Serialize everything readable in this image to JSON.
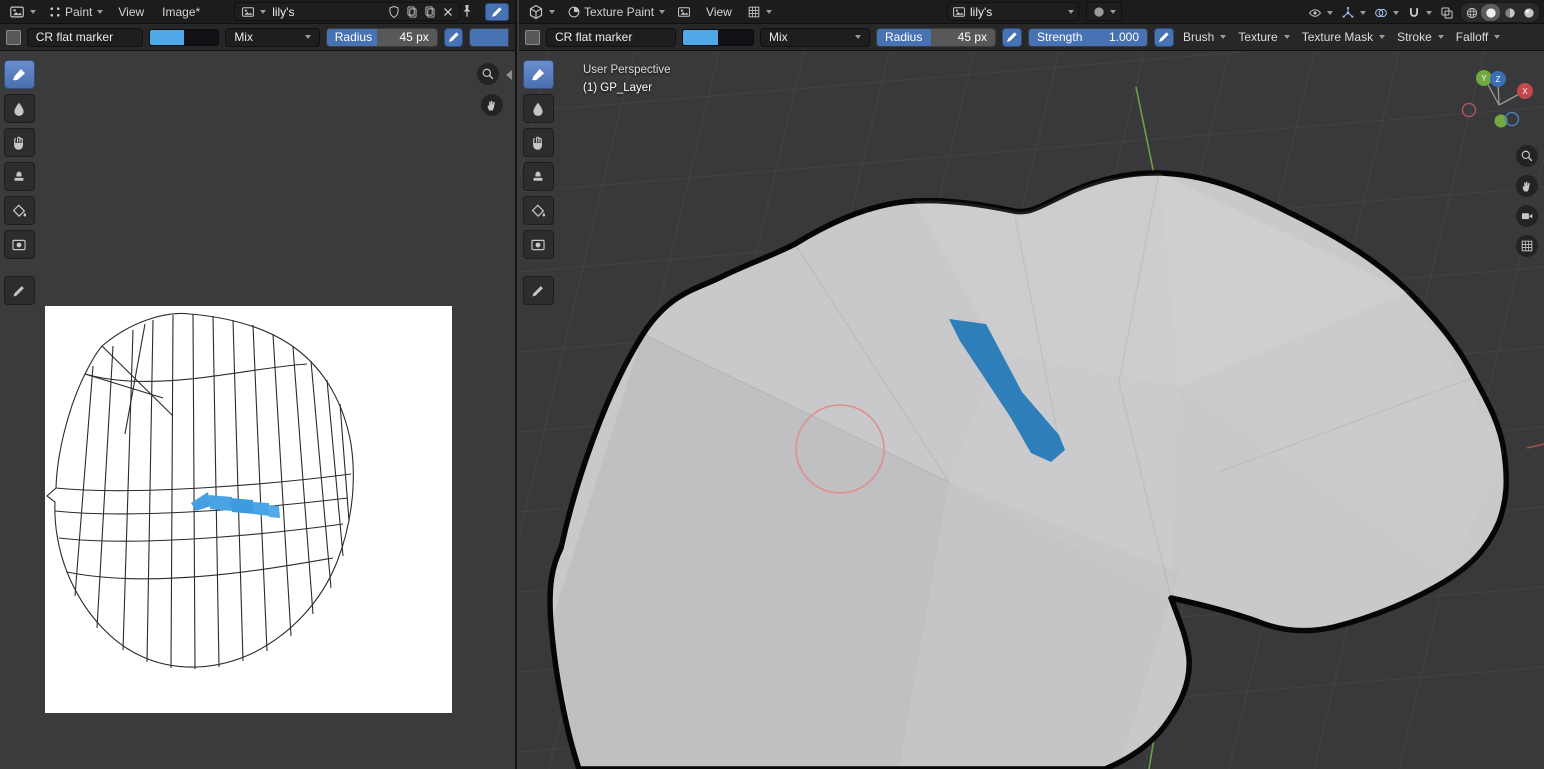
{
  "colors": {
    "accent_blue": "#4772b3",
    "brush_primary": "#4fa8e8",
    "brush_secondary": "#121216",
    "paint_stroke": "#2e7eb9",
    "cursor_pink": "#de8f8f"
  },
  "image_editor": {
    "header": {
      "mode_label": "Paint",
      "view_menu": "View",
      "image_menu": "Image*",
      "datablock_name": "lily's"
    },
    "tool_settings": {
      "brush_name": "CR flat marker",
      "blend_mode": "Mix",
      "radius_label": "Radius",
      "radius_value": "45 px"
    }
  },
  "viewport": {
    "header": {
      "mode_label": "Texture Paint",
      "view_menu": "View",
      "datablock_name": "lily's"
    },
    "tool_settings": {
      "brush_name": "CR flat marker",
      "blend_mode": "Mix",
      "radius_label": "Radius",
      "radius_value": "45 px",
      "strength_label": "Strength",
      "strength_value": "1.000",
      "brush_popover": "Brush",
      "texture_popover": "Texture",
      "texture_mask_popover": "Texture Mask",
      "stroke_popover": "Stroke",
      "falloff_popover": "Falloff"
    },
    "overlay": {
      "view_label": "User Perspective",
      "layer_label": "(1) GP_Layer"
    },
    "gizmo": {
      "x": "X",
      "y": "Y",
      "z": "Z"
    }
  }
}
